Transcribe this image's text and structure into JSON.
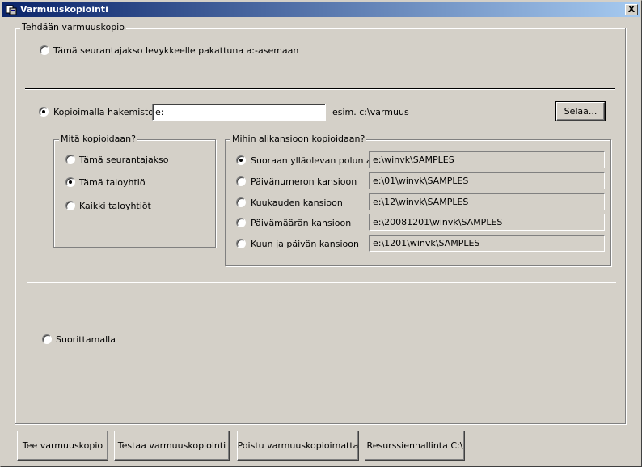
{
  "window": {
    "title": "Varmuuskopiointi",
    "close_label": "X"
  },
  "backup_group": {
    "label": "Tehdään varmuuskopio",
    "option_floppy": {
      "label": "Tämä seurantajakso levykkeelle pakattuna a:-asemaan",
      "checked": false
    },
    "option_directory": {
      "label": "Kopioimalla hakemistoon",
      "checked": true
    },
    "directory_input": {
      "value": "e:"
    },
    "directory_example": "esim. c:\\varmuus",
    "browse_label": "Selaa...",
    "option_run": {
      "label": "Suorittamalla",
      "checked": false
    }
  },
  "what_group": {
    "label": "Mitä kopioidaan?",
    "options": [
      {
        "label": "Tämä seurantajakso",
        "checked": false
      },
      {
        "label": "Tämä taloyhtiö",
        "checked": true
      },
      {
        "label": "Kaikki taloyhtiöt",
        "checked": false
      }
    ]
  },
  "subfolder_group": {
    "label": "Mihin alikansioon kopioidaan?",
    "options": [
      {
        "label": "Suoraan ylläolevan polun alle",
        "path": "e:\\winvk\\SAMPLES",
        "checked": true
      },
      {
        "label": "Päivänumeron kansioon",
        "path": "e:\\01\\winvk\\SAMPLES",
        "checked": false
      },
      {
        "label": "Kuukauden kansioon",
        "path": "e:\\12\\winvk\\SAMPLES",
        "checked": false
      },
      {
        "label": "Päivämäärän kansioon",
        "path": "e:\\20081201\\winvk\\SAMPLES",
        "checked": false
      },
      {
        "label": "Kuun ja päivän kansioon",
        "path": "e:\\1201\\winvk\\SAMPLES",
        "checked": false
      }
    ]
  },
  "footer": {
    "make_backup": "Tee varmuuskopio",
    "test_backup": "Testaa varmuuskopiointi",
    "exit_without_backup": "Poistu varmuuskopioimatta",
    "explorer": "Resurssienhallinta C:\\"
  }
}
